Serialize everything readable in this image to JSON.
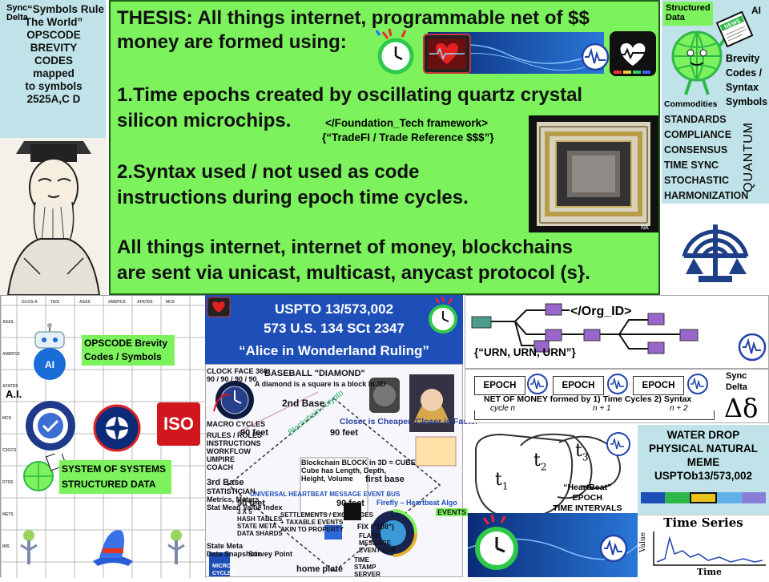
{
  "top_left": {
    "corner": [
      "Sync",
      "Delta"
    ],
    "lines": [
      "“Symbols Rule",
      "The World”",
      "OPSCODE",
      "BREVITY",
      "CODES",
      "mapped",
      "to symbols",
      "2525A,C D"
    ]
  },
  "main": {
    "thesis_line1": "THESIS: All things internet, programmable net of $$",
    "thesis_line2": "money are formed using:",
    "point1_line1": "1.Time epochs created by oscillating quartz crystal",
    "point1_line2": "silicon microchips.",
    "framework_line1": "</Foundation_Tech framework>",
    "framework_line2": "{“TradeFI / Trade Reference $$$”}",
    "point2_line1": "2.Syntax used / not used as code",
    "point2_line2": "instructions during epoch time cycles.",
    "point3_line1": "All things internet, internet of money, blockchains",
    "point3_line2": "are sent via unicast, multicast, anycast protocol (s}."
  },
  "right_top": {
    "structured": [
      "Structured",
      "Data"
    ],
    "ai": "AI",
    "news": "NEWS",
    "brevity": [
      "Brevity",
      "Codes /",
      "Syntax",
      "Symbols"
    ],
    "commodities": "Commodities",
    "list": [
      "STANDARDS",
      "COMPLIANCE",
      "CONSENSUS",
      "TIME SYNC",
      "STOCHASTIC",
      "HARMONIZATION"
    ],
    "quantum": "QUANTUM"
  },
  "bottom_left": {
    "opscode": [
      "OPSCODE Brevity",
      "Codes / Symbols"
    ],
    "ai_badge": "AI",
    "ai_label": "A.I.",
    "iso": "ISO",
    "sos": [
      "SYSTEM OF SYSTEMS",
      "STRUCTURED DATA"
    ],
    "grid_headers": [
      "GCCS-A",
      "TAIS",
      "ASAS",
      "AMDPCS",
      "AFATDS",
      "MCS"
    ],
    "grid_rows": [
      "ASAS",
      "AMDPCS",
      "AFATDS",
      "MCS",
      "C2GCS",
      "DTSS",
      "METS",
      "IMS"
    ]
  },
  "uspto": {
    "line1": "USPTO  13/573,002",
    "line2": "573 U.S. 134 SCt 2347",
    "line3": "“Alice in Wonderland Ruling”"
  },
  "diamond": {
    "title": "BASEBALL \"DIAMOND\"",
    "subtitle": "A diamond is a square is a block in 3D",
    "clock": "CLOCK FACE 360°",
    "clock_deg": "90 / 90 / 90 / 90",
    "second_base": "2nd Base",
    "third_base": "3rd Base",
    "first_base": "first base",
    "home_plate": "home plate",
    "feet": "90 feet",
    "block": [
      "Blockchain BLOCK in 3D = CUBE",
      "Cube has Length, Depth,",
      "Height, Volume"
    ],
    "bus": "UNIVERSAL HEARTBEAT MESSAGE EVENT BUS",
    "settlements": [
      "SETTLEMENTS / EXCHANGES",
      "+ TAXABLE EVENTS",
      "AKIN TO PROPERTY"
    ],
    "survey": "Survey Point",
    "closer": "Closer is Cheaper, Closer is Faster",
    "firefly": "Firefly – Heartbeat Algo",
    "events": "EVENTS",
    "stamp": [
      "TIME",
      "STAMP",
      "SERVER"
    ],
    "flash": [
      "FLASH",
      "MESSAGE",
      "EVENT BUS"
    ],
    "fix": "FIX (\"108\")",
    "macro": "MACRO CYCLES",
    "micro": [
      "MICRO",
      "CYCLES"
    ],
    "state_meta": [
      "State Meta",
      "Data Snapshots"
    ],
    "hash": [
      "3 X 5",
      "HASH TABLES",
      "STATE META",
      "DATA SHARDS"
    ],
    "rules": [
      "RULES / ROLES",
      "INSTRUCTIONS",
      "WORKFLOW",
      "UMPIRE",
      "COACH"
    ],
    "stats": [
      "STATISTICIAN",
      "Metrics, Meters",
      "Stat Mean Value Index"
    ]
  },
  "right_bottom": {
    "org_id": "</Org_ID>",
    "urn": "{“URN, URN, URN”}",
    "epochs": [
      "EPOCH",
      "EPOCH",
      "EPOCH"
    ],
    "sync": [
      "Sync",
      "Delta"
    ],
    "net_of_money": "NET OF MONEY formed by 1) Time Cycles 2) Syntax",
    "cycles": [
      "cycle n",
      "n + 1",
      "n + 2"
    ],
    "delta": "Δδ",
    "drops": [
      "t",
      "t",
      "t"
    ],
    "drop_subs": [
      "1",
      "2",
      "3"
    ],
    "heartbeat": [
      "“HeartBeat”",
      "EPOCH",
      "TIME INTERVALS"
    ],
    "water_drop": [
      "WATER DROP",
      "PHYSICAL NATURAL",
      "MEME",
      "USPTOb13/573,002"
    ],
    "time_series": "Time Series",
    "value_axis": "Value",
    "time_axis": "Time"
  },
  "colors": {
    "main_green": "#7cf25d",
    "panel_blue": "#bfe3e8",
    "uspto_blue": "#1e4fb8",
    "chip_purple": "#9966cc",
    "chip_teal": "#4c9c8c"
  }
}
